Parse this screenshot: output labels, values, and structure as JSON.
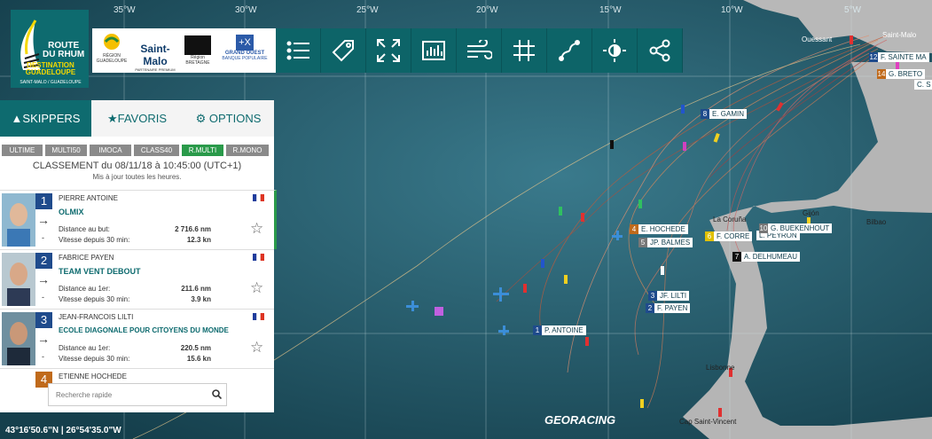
{
  "map": {
    "longitudes": [
      "35°W",
      "30°W",
      "25°W",
      "20°W",
      "15°W",
      "10°W",
      "5°W"
    ],
    "cities": [
      "Ouessant",
      "La Coruña",
      "Gijón",
      "Bilbao",
      "Lisbonne",
      "Cap Saint-Vincent"
    ],
    "boats": [
      {
        "rank": "8",
        "label": "E. GAMIN",
        "color": "#1f4b8c"
      },
      {
        "rank": "4",
        "label": "E. HOCHEDE",
        "color": "#c06a1b"
      },
      {
        "rank": "5",
        "label": "JP. BALMES",
        "color": "#777777"
      },
      {
        "rank": "6",
        "label": "F. CORRE",
        "color": "#e0c000"
      },
      {
        "rank": "",
        "label": "L. PEYRON",
        "color": "#ffffff"
      },
      {
        "rank": "10",
        "label": "G. BUEKENHOUT",
        "color": "#777777"
      },
      {
        "rank": "7",
        "label": "A. DELHUMEAU",
        "color": "#111111"
      },
      {
        "rank": "3",
        "label": "JF. LILTI",
        "color": "#1f4b8c"
      },
      {
        "rank": "2",
        "label": "F. PAYEN",
        "color": "#1f4b8c"
      },
      {
        "rank": "1",
        "label": "P. ANTOINE",
        "color": "#1f4b8c"
      },
      {
        "rank": "12",
        "label": "F. SAINTE MA",
        "color": "#1f4b8c"
      },
      {
        "rank": "14",
        "label": "G. BRETO",
        "color": "#c06a1b"
      },
      {
        "rank": "",
        "label": "C. S",
        "color": "#ffffff"
      },
      {
        "rank": "",
        "label": "Saint-Malo",
        "color": "#ffffff"
      }
    ],
    "coords": "43°16'50.6\"N | 26°54'35.0\"W",
    "brand": "GEORACING"
  },
  "logo": {
    "line1": "ROUTE",
    "line2": "DU RHUM",
    "line3": "DESTINATION",
    "line4": "GUADELOUPE",
    "line5": "SAINT-MALO / GUADELOUPE"
  },
  "partners": [
    "RÉGION GUADELOUPE",
    "Saint-Malo",
    "PARTENAIRE PREMIUM",
    "Région BRETAGNE",
    "GRAND OUEST",
    "BANQUE POPULAIRE"
  ],
  "toolbar": [
    "list-icon",
    "tag-icon",
    "expand-icon",
    "chart-icon",
    "wind-icon",
    "grid-icon",
    "route-icon",
    "contrast-icon",
    "share-icon"
  ],
  "panel": {
    "tabs": [
      "SKIPPERS",
      "FAVORIS",
      "OPTIONS"
    ],
    "classes": [
      "ULTIME",
      "MULTI50",
      "IMOCA",
      "CLASS40",
      "R.MULTI",
      "R.MONO"
    ],
    "active_class": "R.MULTI",
    "ranking_title": "CLASSEMENT du 08/11/18 à 10:45:00 (UTC+1)",
    "ranking_sub": "Mis à jour toutes les heures.",
    "skippers": [
      {
        "rank": "1",
        "name": "PIERRE ANTOINE",
        "boat": "OLMIX",
        "label1": "Distance au but:",
        "value1": "2 716.6 nm",
        "label2": "Vitesse depuis 30 min:",
        "value2": "12.3 kn"
      },
      {
        "rank": "2",
        "name": "FABRICE PAYEN",
        "boat": "TEAM VENT DEBOUT",
        "label1": "Distance au 1er:",
        "value1": "211.6 nm",
        "label2": "Vitesse depuis 30 min:",
        "value2": "3.9 kn"
      },
      {
        "rank": "3",
        "name": "JEAN-FRANCOIS LILTI",
        "boat": "ECOLE DIAGONALE POUR CITOYENS DU MONDE",
        "label1": "Distance au 1er:",
        "value1": "220.5 nm",
        "label2": "Vitesse depuis 30 min:",
        "value2": "15.6 kn"
      },
      {
        "rank": "4",
        "name": "ETIENNE HOCHEDE"
      }
    ],
    "search_placeholder": "Recherche rapide"
  }
}
